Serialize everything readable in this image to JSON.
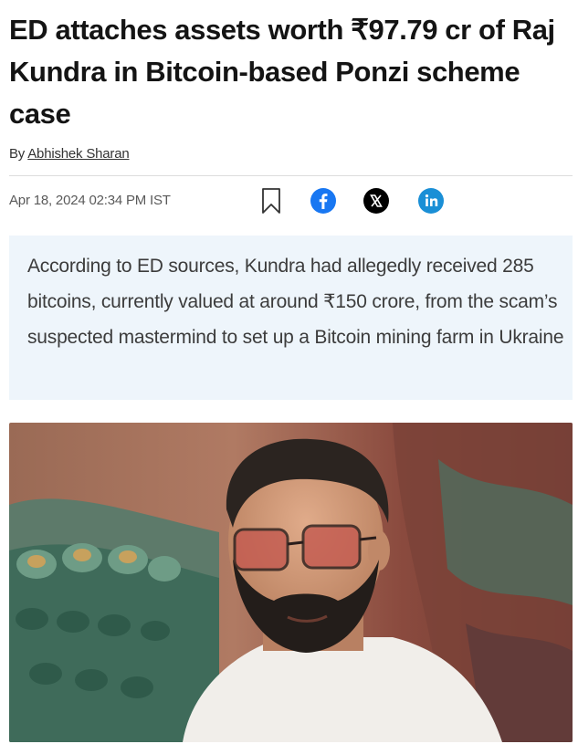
{
  "article": {
    "headline": "ED attaches assets worth ₹97.79 cr of Raj Kundra in Bitcoin-based Ponzi scheme case",
    "byline_prefix": "By",
    "author": "Abhishek Sharan",
    "date": "Apr 18, 2024 02:34 PM IST",
    "summary": "According to ED sources, Kundra had allegedly received 285 bitcoins, currently valued at around ₹150 crore, from the scam’s suspected mastermind to set up a Bitcoin mining farm in Ukraine"
  },
  "share": {
    "icons": [
      "bookmark-icon",
      "facebook-icon",
      "x-icon",
      "linkedin-icon"
    ],
    "colors": {
      "facebook": "#1877f2",
      "x": "#000000",
      "linkedin": "#1a8fd6"
    }
  },
  "photo": {
    "subject": "man-with-beard-tinted-glasses-white-tshirt"
  }
}
